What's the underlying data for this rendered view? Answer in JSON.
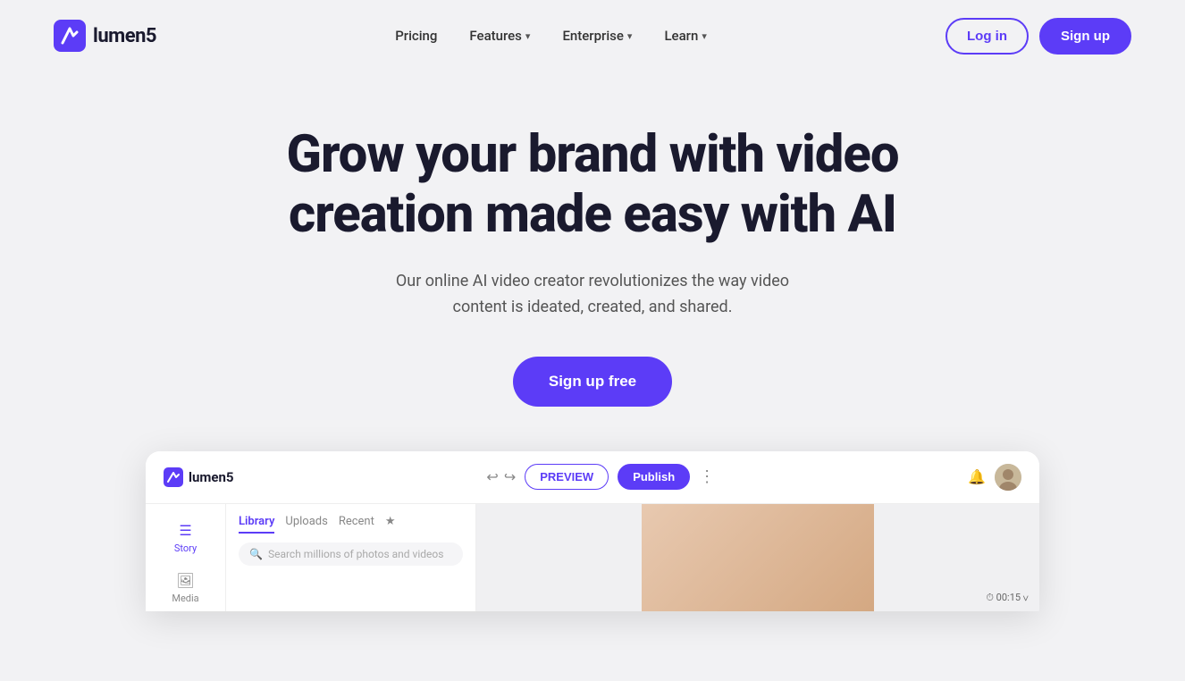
{
  "brand": {
    "name": "lumen5",
    "logo_alt": "Lumen5 logo"
  },
  "nav": {
    "links": [
      {
        "label": "Pricing",
        "has_dropdown": false
      },
      {
        "label": "Features",
        "has_dropdown": true
      },
      {
        "label": "Enterprise",
        "has_dropdown": true
      },
      {
        "label": "Learn",
        "has_dropdown": true
      }
    ],
    "login_label": "Log in",
    "signup_label": "Sign up"
  },
  "hero": {
    "title": "Grow your brand with video creation made easy with AI",
    "subtitle": "Our online AI video creator revolutionizes the way video content is ideated, created, and shared.",
    "cta_label": "Sign up free"
  },
  "app_preview": {
    "logo_text": "lumen5",
    "undo_icon": "↩",
    "redo_icon": "↪",
    "preview_label": "PREVIEW",
    "publish_label": "Publish",
    "dots_label": "⋮",
    "bell_icon": "🔔",
    "sidebar_items": [
      {
        "label": "Story",
        "icon": "☰"
      },
      {
        "label": "Media",
        "icon": "🖼"
      }
    ],
    "panel_tabs": [
      {
        "label": "Library",
        "active": true
      },
      {
        "label": "Uploads",
        "active": false
      },
      {
        "label": "Recent",
        "active": false
      }
    ],
    "search_placeholder": "Search millions of photos and videos",
    "timer": "⏱ 00:15 ∨"
  },
  "colors": {
    "brand_purple": "#5c3cf7",
    "bg_light": "#f2f2f4",
    "text_dark": "#1a1a2e",
    "text_mid": "#555555"
  }
}
